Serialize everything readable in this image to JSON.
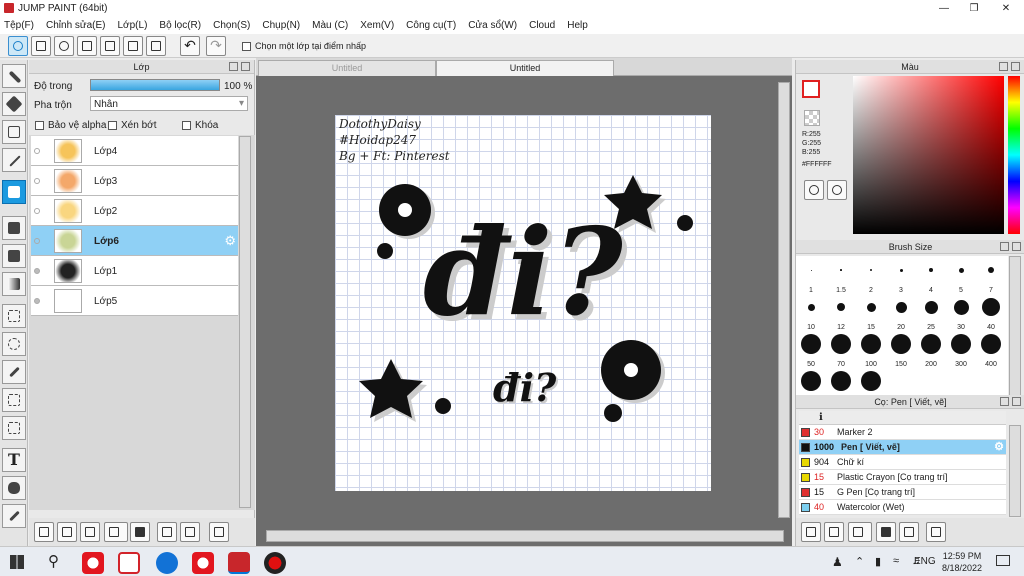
{
  "window": {
    "title": "JUMP PAINT (64bit)",
    "minimize_icon": "minimize-icon",
    "maximize_icon": "maximize-icon",
    "close_icon": "close-icon"
  },
  "menu": [
    "Tệp(F)",
    "Chỉnh sửa(E)",
    "Lớp(L)",
    "Bộ lọc(R)",
    "Chọn(S)",
    "Chụp(N)",
    "Màu (C)",
    "Xem(V)",
    "Công cụ(T)",
    "Cửa sổ(W)",
    "Cloud",
    "Help"
  ],
  "toolbar": {
    "select_layer_label": "Chọn một lớp tại điểm nhấp"
  },
  "layer_panel": {
    "title": "Lớp",
    "opacity_label": "Độ trong",
    "opacity_value": "100 %",
    "opacity": 1.0,
    "blend_label": "Pha trộn",
    "blend_value": "Nhân",
    "protect_alpha": "Bảo vệ alpha",
    "clipping": "Xén bớt",
    "lock": "Khóa",
    "layers": [
      {
        "name": "Lớp4",
        "color": "#f6c45a",
        "visible": false,
        "selected": false
      },
      {
        "name": "Lớp3",
        "color": "#f4a86a",
        "visible": false,
        "selected": false
      },
      {
        "name": "Lớp2",
        "color": "#f9d680",
        "visible": false,
        "selected": false
      },
      {
        "name": "Lớp6",
        "color": "#c9d596",
        "visible": false,
        "selected": true
      },
      {
        "name": "Lớp1",
        "color": "#222222",
        "visible": true,
        "selected": false
      },
      {
        "name": "Lớp5",
        "color": "#ffffff",
        "visible": true,
        "selected": false
      }
    ]
  },
  "doc_tabs": [
    "Untitled",
    "Untitled"
  ],
  "canvas_text": {
    "credit1": "DotothyDaisy",
    "credit2": "#Hoidap247",
    "credit3": "Bg + Ft: Pinterest",
    "big_word": "đi?",
    "small_word": "đi?"
  },
  "color_panel": {
    "title": "Màu",
    "r": "R:255",
    "g": "G:255",
    "b": "B:255",
    "hex": "#FFFFFF"
  },
  "brush_panel": {
    "title": "Brush Size",
    "sizes": [
      "1",
      "1.5",
      "2",
      "3",
      "4",
      "5",
      "7",
      "10",
      "12",
      "15",
      "20",
      "25",
      "30",
      "40",
      "50",
      "70",
      "100",
      "150",
      "200",
      "300",
      "400",
      "",
      "",
      ""
    ]
  },
  "tool_panel": {
    "title": "Cọ: Pen [ Viết, vẽ]",
    "tools": [
      {
        "num": "30",
        "name": "Marker 2",
        "color": "#e03030",
        "selected": false
      },
      {
        "num": "1000",
        "name": "Pen [ Viết, vẽ]",
        "color": "#111111",
        "selected": true
      },
      {
        "num": "904",
        "name": "Chữ kí",
        "color": "#e8d800",
        "selected": false
      },
      {
        "num": "15",
        "name": "Plastic Crayon [Cọ trang trí]",
        "color": "#e8d800",
        "selected": false
      },
      {
        "num": "15",
        "name": "G Pen [Cọ trang trí]",
        "color": "#e03030",
        "selected": false
      },
      {
        "num": "40",
        "name": "Watercolor (Wet)",
        "color": "#7ccff0",
        "selected": false
      }
    ]
  },
  "taskbar": {
    "lang": "ENG",
    "time": "12:59 PM",
    "date": "8/18/2022"
  }
}
